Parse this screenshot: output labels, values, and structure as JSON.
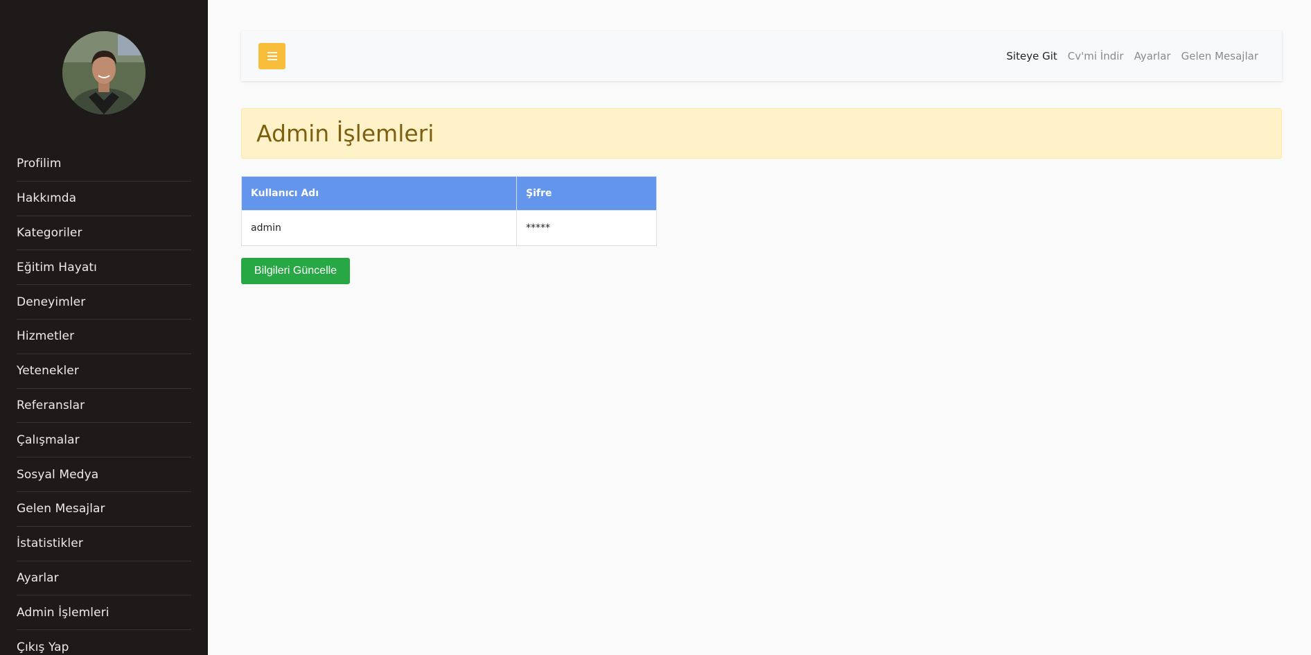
{
  "sidebar": {
    "items": [
      {
        "label": "Profilim"
      },
      {
        "label": "Hakkımda"
      },
      {
        "label": "Kategoriler"
      },
      {
        "label": "Eğitim Hayatı"
      },
      {
        "label": "Deneyimler"
      },
      {
        "label": "Hizmetler"
      },
      {
        "label": "Yetenekler"
      },
      {
        "label": "Referanslar"
      },
      {
        "label": "Çalışmalar"
      },
      {
        "label": "Sosyal Medya"
      },
      {
        "label": "Gelen Mesajlar"
      },
      {
        "label": "İstatistikler"
      },
      {
        "label": "Ayarlar"
      },
      {
        "label": "Admin İşlemleri"
      },
      {
        "label": "Çıkış Yap"
      }
    ]
  },
  "topbar": {
    "toggle_icon": "menu-icon",
    "links": [
      {
        "label": "Siteye Git"
      },
      {
        "label": "Cv'mi İndir"
      },
      {
        "label": "Ayarlar"
      },
      {
        "label": "Gelen Mesajlar"
      }
    ]
  },
  "page": {
    "title": "Admin İşlemleri"
  },
  "table": {
    "headers": [
      "Kullanıcı Adı",
      "Şifre"
    ],
    "rows": [
      [
        "admin",
        "*****"
      ]
    ]
  },
  "actions": {
    "update_label": "Bilgileri Güncelle"
  },
  "colors": {
    "sidebar_bg": "#1e1a19",
    "toggle_bg": "#f7bd3b",
    "title_bg": "#fff2c9",
    "title_text": "#7d5f10",
    "table_header_bg": "#6495ed",
    "update_button_bg": "#28a745"
  }
}
